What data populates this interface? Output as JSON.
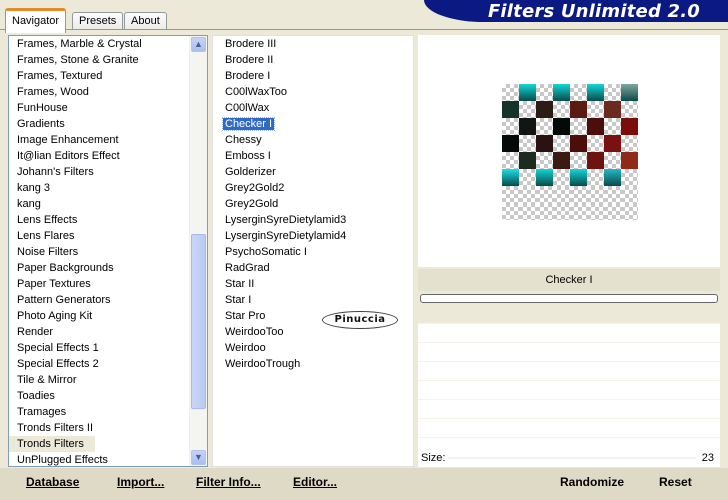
{
  "tabs": [
    "Navigator",
    "Presets",
    "About"
  ],
  "banner_title": "Filters Unlimited 2.0",
  "categories": [
    "Frames, Marble & Crystal",
    "Frames, Stone & Granite",
    "Frames, Textured",
    "Frames, Wood",
    "FunHouse",
    "Gradients",
    "Image Enhancement",
    "It@lian Editors Effect",
    "Johann's Filters",
    "kang 3",
    "kang",
    "Lens Effects",
    "Lens Flares",
    "Noise Filters",
    "Paper Backgrounds",
    "Paper Textures",
    "Pattern Generators",
    "Photo Aging Kit",
    "Render",
    "Special Effects 1",
    "Special Effects 2",
    "Tile & Mirror",
    "Toadies",
    "Tramages",
    "Tronds Filters II",
    "Tronds Filters",
    "UnPlugged Effects"
  ],
  "selected_category": "Tronds Filters",
  "filters": [
    "Brodere III",
    "Brodere II",
    "Brodere I",
    "C00lWaxToo",
    "C00lWax",
    "Checker I",
    "Chessy",
    "Emboss I",
    "Golderizer",
    "Grey2Gold2",
    "Grey2Gold",
    "LyserginSyreDietylamid3",
    "LyserginSyreDietylamid4",
    "PsychoSomatic I",
    "RadGrad",
    "Star II",
    "Star I",
    "Star Pro",
    "WeirdooToo",
    "Weirdoo",
    "WeirdooTrough"
  ],
  "selected_filter": "Checker I",
  "watermark": "Pinuccia",
  "preview": {
    "filter_name": "Checker I",
    "pattern": [
      [
        "T",
        "cy",
        "T",
        "cy",
        "T",
        "cy",
        "T",
        "cy2"
      ],
      [
        "dg",
        "T",
        "db",
        "T",
        "br",
        "T",
        "rb",
        "T"
      ],
      [
        "T",
        "dk",
        "T",
        "bk",
        "T",
        "br2",
        "T",
        "red"
      ],
      [
        "bk",
        "T",
        "dbr",
        "T",
        "rbr",
        "T",
        "dr",
        "T"
      ],
      [
        "T",
        "dg2",
        "T",
        "rbr2",
        "T",
        "br3",
        "T",
        "rbr3"
      ],
      [
        "cy3",
        "T",
        "cy",
        "T",
        "cy",
        "T",
        "cy4",
        "T"
      ],
      [
        "T",
        "T",
        "T",
        "T",
        "T",
        "T",
        "T",
        "T"
      ],
      [
        "T",
        "T",
        "T",
        "T",
        "T",
        "T",
        "T",
        "T"
      ]
    ],
    "colors": {
      "cy": "#14d6d6",
      "cy2": "#7fa8a0",
      "cy3": "#19e0e8",
      "cy4": "#24b8c4",
      "dg": "#15332a",
      "dg2": "#1c2a20",
      "db": "#2b1d16",
      "br": "#5a1b14",
      "rb": "#6b2a1e",
      "dk": "#101612",
      "bk": "#050a08",
      "br2": "#4a0e0c",
      "red": "#7c0e0a",
      "dbr": "#2a1210",
      "rbr": "#4d0d0b",
      "dr": "#7a1010",
      "rbr2": "#3a1a12",
      "br3": "#6e1410",
      "rbr3": "#8e2a18"
    }
  },
  "size": {
    "label": "Size:",
    "value": "23"
  },
  "buttons": {
    "database": "Database",
    "import": "Import...",
    "filter_info": "Filter Info...",
    "editor": "Editor...",
    "randomize": "Randomize",
    "reset": "Reset"
  }
}
